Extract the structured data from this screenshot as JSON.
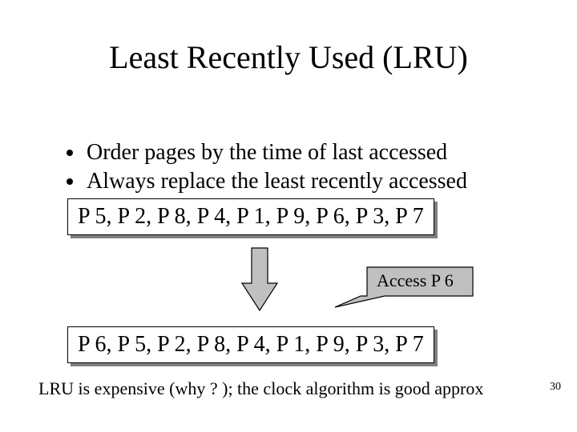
{
  "title": "Least Recently Used (LRU)",
  "bullets": [
    "Order pages by the time of last accessed",
    "Always replace the least recently accessed"
  ],
  "box1": "P 5, P 2, P 8, P 4, P 1, P 9, P 6, P 3, P 7",
  "callout": "Access P 6",
  "box2": "P 6, P 5, P 2, P 8, P 4, P 1, P 9, P 3, P 7",
  "footnote": "LRU is expensive (why ? ); the clock algorithm is good approx",
  "page_number": "30"
}
